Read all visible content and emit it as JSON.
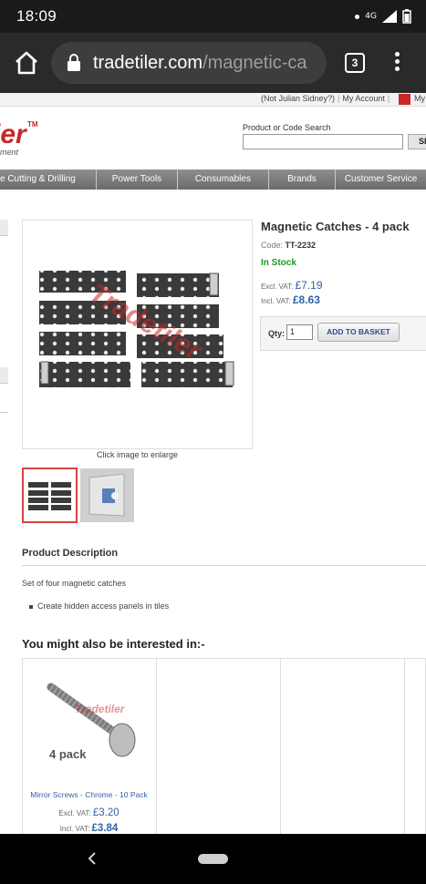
{
  "status_bar": {
    "time": "18:09",
    "network": "4G"
  },
  "browser": {
    "url_domain": "tradetiler.com",
    "url_path": "/magnetic-ca",
    "tab_count": "3"
  },
  "header": {
    "account_links": [
      "(Not Julian Sidney?)",
      "My Account",
      "My"
    ],
    "logo_fragment": "ler",
    "logo_tm": "TM",
    "logo_tagline": "ment",
    "search_label": "Product or Code Search",
    "search_placeholder": "",
    "search_button": "SE"
  },
  "nav": {
    "items": [
      {
        "label": "e Cutting & Drilling"
      },
      {
        "label": "Power Tools"
      },
      {
        "label": "Consumables"
      },
      {
        "label": "Brands"
      },
      {
        "label": "Customer Service"
      }
    ]
  },
  "product": {
    "title": "Magnetic Catches - 4 pack",
    "code_label": "Code:",
    "code": "TT-2232",
    "stock": "In Stock",
    "excl_label": "Excl. VAT:",
    "excl_price": "£7.19",
    "incl_label": "Incl. VAT:",
    "incl_price": "£8.63",
    "qty_label": "Qty:",
    "qty_value": "1",
    "add_button": "ADD TO BASKET",
    "enlarge_hint": "Click image to enlarge",
    "watermark": "Tradetiler"
  },
  "description": {
    "title": "Product Description",
    "text": "Set of four magnetic catches",
    "bullets": [
      "Create hidden access panels in tiles"
    ]
  },
  "related": {
    "title": "You might also be interested in:-",
    "items": [
      {
        "name": "Mirror Screws - Chrome - 10 Pack",
        "image_caption": "4 pack",
        "excl_label": "Excl. VAT:",
        "excl_price": "£3.20",
        "incl_label": "Incl. VAT:",
        "incl_price": "£3.84"
      }
    ]
  },
  "colors": {
    "brand_red": "#c62828",
    "price_blue": "#3361a6",
    "stock_green": "#1e9a1e",
    "nav_grey": "#7a7a7a"
  }
}
